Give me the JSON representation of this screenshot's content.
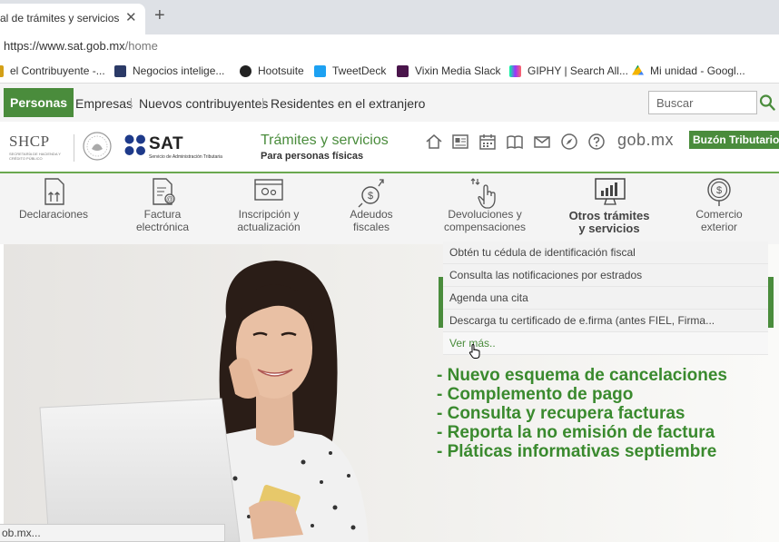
{
  "browser": {
    "tab_title": "al de trámites y servicios -",
    "url_host": "https://www.sat.gob.mx",
    "url_path": "/home",
    "bookmarks": [
      {
        "label": "el Contribuyente -...",
        "color": "#d4a017"
      },
      {
        "label": "Negocios intelige...",
        "color": "#2b3a67"
      },
      {
        "label": "Hootsuite",
        "color": "#222222"
      },
      {
        "label": "TweetDeck",
        "color": "#1da1f2"
      },
      {
        "label": "Vixin Media Slack",
        "color": "#4a154b"
      },
      {
        "label": "GIPHY | Search All...",
        "color": "#111111"
      },
      {
        "label": "Mi unidad - Googl...",
        "color": "#f4b400"
      }
    ]
  },
  "topnav": {
    "active": "Personas",
    "links": [
      "Empresas",
      "Nuevos contribuyentes",
      "Residentes en el extranjero"
    ],
    "search_placeholder": "Buscar"
  },
  "header": {
    "shcp": "SHCP",
    "shcp_sub": "SECRETARÍA DE HACIENDA Y CRÉDITO PÚBLICO",
    "sat": "SAT",
    "sat_sub": "Servicio de Administración Tributaria",
    "title": "Trámites y servicios",
    "subtitle": "Para personas físicas",
    "gob": "gob.mx",
    "buzon": "Buzón Tributario",
    "icons": [
      "home-icon",
      "news-icon",
      "calendar-icon",
      "book-icon",
      "mail-icon",
      "compass-icon",
      "help-icon"
    ]
  },
  "categories": [
    {
      "line1": "Declaraciones",
      "line2": ""
    },
    {
      "line1": "Factura",
      "line2": "electrónica"
    },
    {
      "line1": "Inscripción y",
      "line2": "actualización"
    },
    {
      "line1": "Adeudos",
      "line2": "fiscales"
    },
    {
      "line1": "Devoluciones y",
      "line2": "compensaciones"
    },
    {
      "line1": "Otros trámites",
      "line2": "y servicios"
    },
    {
      "line1": "Comercio",
      "line2": "exterior"
    }
  ],
  "dropdown": {
    "items": [
      "Obtén tu cédula de identificación fiscal",
      "Consulta las notificaciones por estrados",
      "Agenda una cita",
      "Descarga tu certificado de e.firma (antes FIEL, Firma..."
    ],
    "more": "Ver más.."
  },
  "promo": [
    "- Nuevo esquema de cancelaciones",
    "- Complemento de pago",
    "- Consulta y recupera facturas",
    "- Reporta la no emisión de factura",
    "- Pláticas informativas septiembre"
  ],
  "status": "ob.mx..."
}
